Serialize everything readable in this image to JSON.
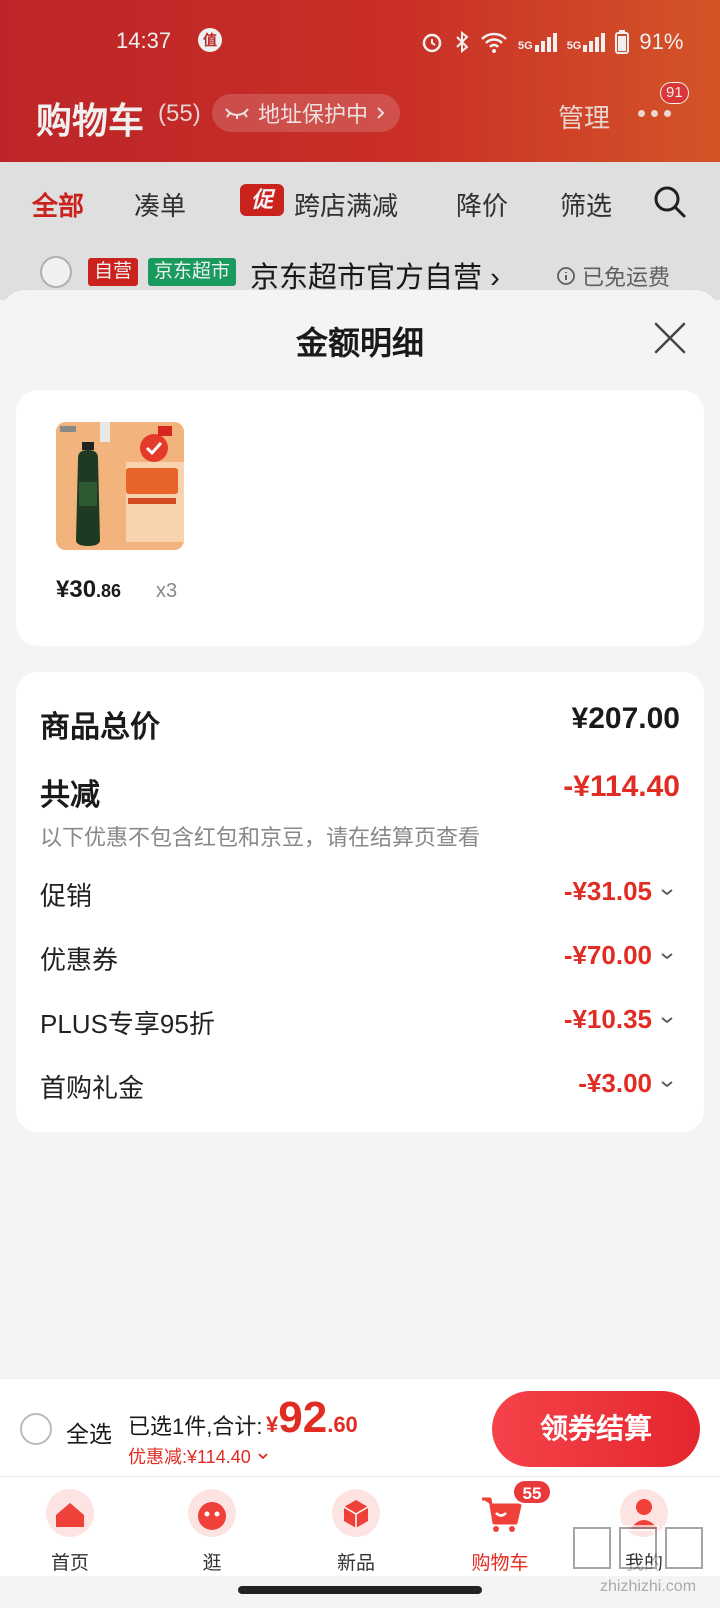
{
  "status_bar": {
    "time": "14:37",
    "zhi_badge": "值",
    "network_a": "5G",
    "network_b": "5G",
    "battery": "91%"
  },
  "header": {
    "title": "购物车",
    "count": "(55)",
    "address_label": "地址保护中",
    "manage": "管理",
    "more_badge": "91"
  },
  "tabs": [
    {
      "label": "全部"
    },
    {
      "label": "凑单"
    },
    {
      "label": "跨店满减",
      "promo_icon": "促"
    },
    {
      "label": "降价"
    },
    {
      "label": "筛选"
    }
  ],
  "shop": {
    "tag_self": "自营",
    "tag_market": "京东超市",
    "name": "京东超市官方自营",
    "shipping": "已免运费"
  },
  "sheet": {
    "title": "金额明细",
    "item": {
      "price_int": "¥30",
      "price_dec": ".86",
      "qty": "x3"
    },
    "total_label": "商品总价",
    "total_value": "¥207.00",
    "reduce_label": "共减",
    "reduce_value": "-¥114.40",
    "note": "以下优惠不包含红包和京豆，请在结算页查看",
    "details": [
      {
        "label": "促销",
        "value": "-¥31.05"
      },
      {
        "label": "优惠券",
        "value": "-¥70.00"
      },
      {
        "label": "PLUS专享95折",
        "value": "-¥10.35"
      },
      {
        "label": "首购礼金",
        "value": "-¥3.00"
      }
    ]
  },
  "checkout": {
    "select_all": "全选",
    "selected": "已选1件,合计:",
    "currency": "¥",
    "total_int": "92",
    "total_dec": ".60",
    "discount": "优惠减:¥114.40",
    "button": "领券结算"
  },
  "tabbar": {
    "items": [
      {
        "label": "首页"
      },
      {
        "label": "逛"
      },
      {
        "label": "新品"
      },
      {
        "label": "购物车"
      },
      {
        "label": "我的"
      }
    ],
    "cart_badge": "55"
  },
  "watermark": {
    "url": "zhizhizhi.com"
  },
  "colors": {
    "brand_red": "#d7251f",
    "price_red": "#e02c22",
    "green_tag": "#1ba464"
  }
}
